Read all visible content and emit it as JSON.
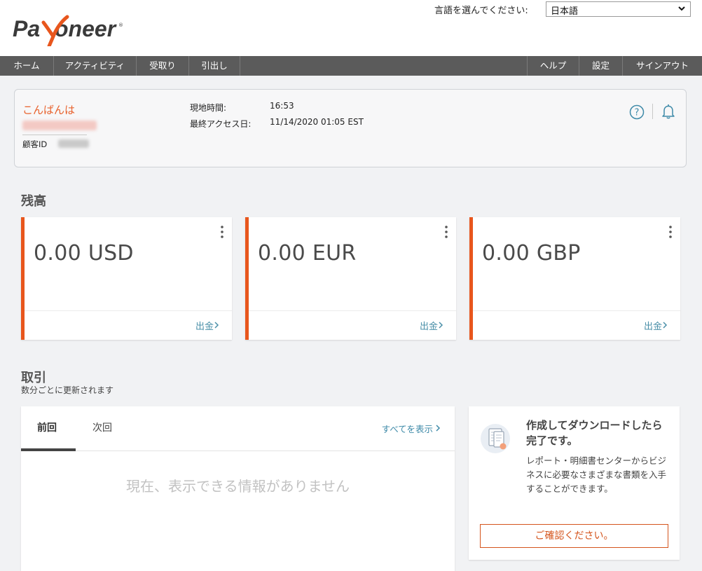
{
  "brand": {
    "name": "Payoneer",
    "accent": "#e8561d",
    "link": "#3e8aa8"
  },
  "language": {
    "label": "言語を選んでください:",
    "selected": "日本語"
  },
  "nav": {
    "left": [
      "ホーム",
      "アクティビティ",
      "受取り",
      "引出し"
    ],
    "right": [
      "ヘルプ",
      "設定",
      "サインアウト"
    ]
  },
  "greeting": {
    "hello": "こんばんは",
    "customer_id_label": "顧客ID",
    "local_time_label": "現地時間:",
    "local_time": "16:53",
    "last_access_label": "最終アクセス日:",
    "last_access": "11/14/2020 01:05 EST"
  },
  "balances": {
    "title": "残高",
    "withdraw_label": "出金",
    "cards": [
      {
        "amount": "0.00 USD"
      },
      {
        "amount": "0.00 EUR"
      },
      {
        "amount": "0.00 GBP"
      }
    ]
  },
  "transactions": {
    "title": "取引",
    "subtitle": "数分ごとに更新されます",
    "tab_prev": "前回",
    "tab_next": "次回",
    "see_all": "すべてを表示",
    "empty": "現在、表示できる情報がありません"
  },
  "promo": {
    "title": "作成してダウンロードしたら完了です。",
    "text": "レポート・明細書センターからビジネスに必要なさまざまな書類を入手することができます。",
    "button": "ご確認ください。"
  }
}
